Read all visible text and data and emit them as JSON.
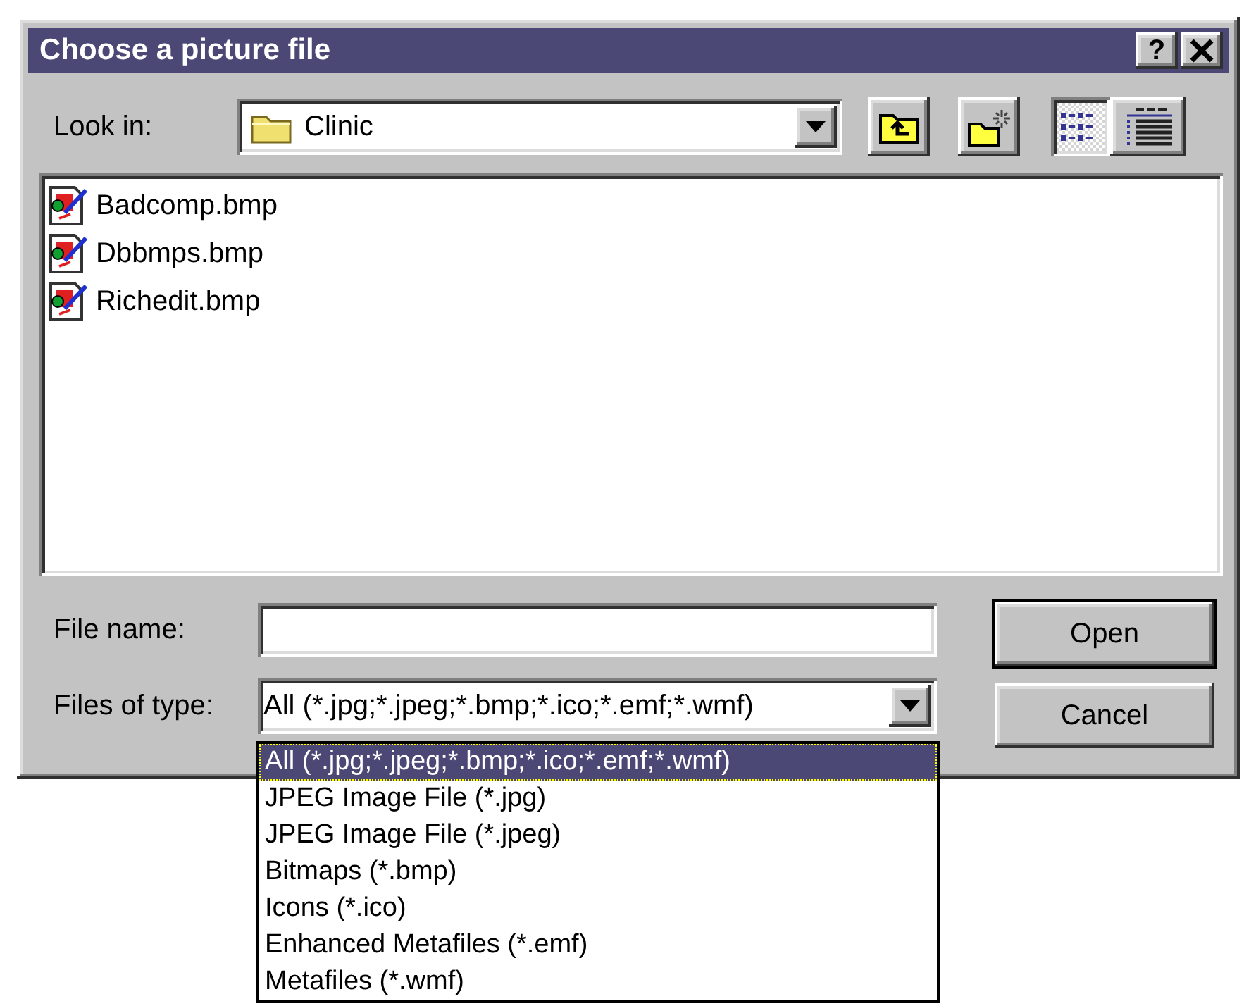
{
  "window": {
    "title": "Choose a picture file",
    "help": "?"
  },
  "look_in": {
    "label": "Look in:",
    "value": "Clinic"
  },
  "view_buttons": [
    {
      "kind": "list",
      "selected": true
    },
    {
      "kind": "details",
      "selected": false
    }
  ],
  "files": [
    {
      "name": "Badcomp.bmp"
    },
    {
      "name": "Dbbmps.bmp"
    },
    {
      "name": "Richedit.bmp"
    }
  ],
  "file_name": {
    "label": "File name:"
  },
  "files_of_type": {
    "label": "Files of type:",
    "value": "All (*.jpg;*.jpeg;*.bmp;*.ico;*.emf;*.wmf)",
    "expanded": true,
    "options": [
      {
        "label": "All (*.jpg;*.jpeg;*.bmp;*.ico;*.emf;*.wmf)",
        "selected": true
      },
      {
        "label": "JPEG Image File (*.jpg)",
        "selected": false
      },
      {
        "label": "JPEG Image File (*.jpeg)",
        "selected": false
      },
      {
        "label": "Bitmaps (*.bmp)",
        "selected": false
      },
      {
        "label": "Icons (*.ico)",
        "selected": false
      },
      {
        "label": "Enhanced Metafiles (*.emf)",
        "selected": false
      },
      {
        "label": "Metafiles (*.wmf)",
        "selected": false
      }
    ]
  },
  "buttons": [
    {
      "label": "Open",
      "default": true
    },
    {
      "label": "Cancel",
      "default": false
    }
  ]
}
